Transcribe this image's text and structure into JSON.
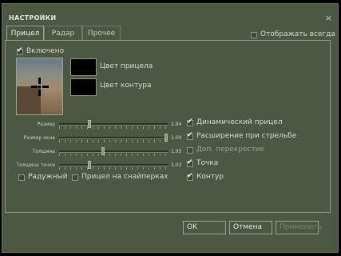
{
  "window": {
    "title": "НАСТРОЙКИ",
    "close_glyph": "×"
  },
  "tabs": [
    {
      "label": "Прицел",
      "active": true
    },
    {
      "label": "Радар",
      "active": false
    },
    {
      "label": "Прочее",
      "active": false
    }
  ],
  "show_always": {
    "label": "Отображать всегда",
    "checked": false
  },
  "enabled": {
    "label": "Включено",
    "checked": true
  },
  "colors": {
    "crosshair_label": "Цвет прицела",
    "outline_label": "Цвет контура",
    "crosshair": "#000000",
    "outline": "#000000"
  },
  "sliders": [
    {
      "label": "Размер",
      "value_text": "1.84",
      "fraction": 0.27
    },
    {
      "label": "Размер окна",
      "value_text": "1.00",
      "fraction": 1.0
    },
    {
      "label": "Толщина",
      "value_text": "1.95",
      "fraction": 0.4
    },
    {
      "label": "Толщина точки",
      "value_text": "1.02",
      "fraction": 0.27
    }
  ],
  "options": [
    {
      "label": "Динамический прицел",
      "checked": true,
      "enabled": true
    },
    {
      "label": "Расширение при стрельбе",
      "checked": true,
      "enabled": true
    },
    {
      "label": "Доп. перекрестие",
      "checked": false,
      "enabled": false
    },
    {
      "label": "Точка",
      "checked": true,
      "enabled": true
    },
    {
      "label": "Контур",
      "checked": true,
      "enabled": true
    }
  ],
  "extra": [
    {
      "label": "Радужный",
      "checked": false
    },
    {
      "label": "Прицел на снайперках",
      "checked": false
    }
  ],
  "buttons": {
    "ok": "OK",
    "cancel": "Отмена",
    "apply": "Применить"
  }
}
